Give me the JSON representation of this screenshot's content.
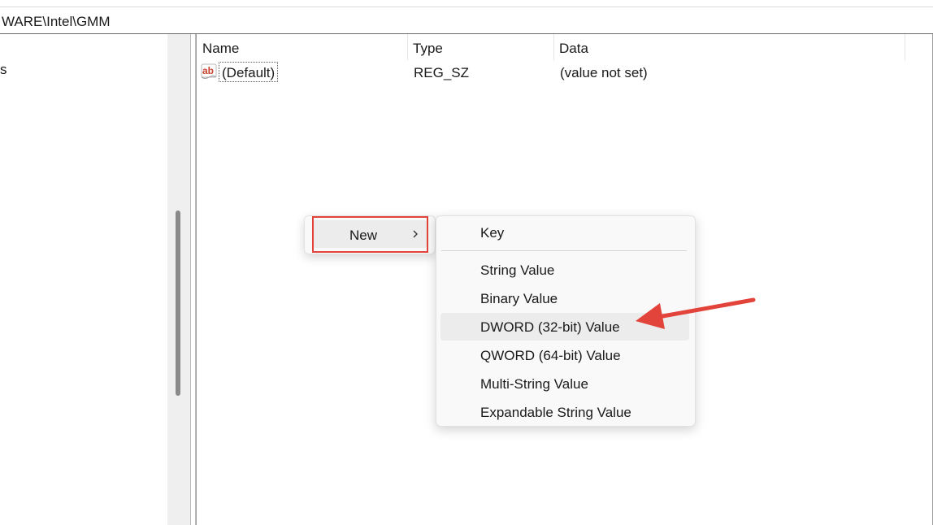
{
  "address_bar": {
    "path": "WARE\\Intel\\GMM"
  },
  "tree": {
    "fragment": "s"
  },
  "values_table": {
    "columns": [
      "Name",
      "Type",
      "Data"
    ],
    "rows": [
      {
        "name": "(Default)",
        "type": "REG_SZ",
        "data": "(value not set)",
        "icon": "string-value-ab-icon"
      }
    ]
  },
  "context_menu": {
    "new_label": "New"
  },
  "submenu": {
    "items": [
      "Key",
      "String Value",
      "Binary Value",
      "DWORD (32-bit) Value",
      "QWORD (64-bit) Value",
      "Multi-String Value",
      "Expandable String Value"
    ],
    "highlighted": "DWORD (32-bit) Value"
  },
  "colors": {
    "annotation_red": "#e2433a",
    "menu_background": "#f9f9f9",
    "hover_background": "#ececec"
  }
}
